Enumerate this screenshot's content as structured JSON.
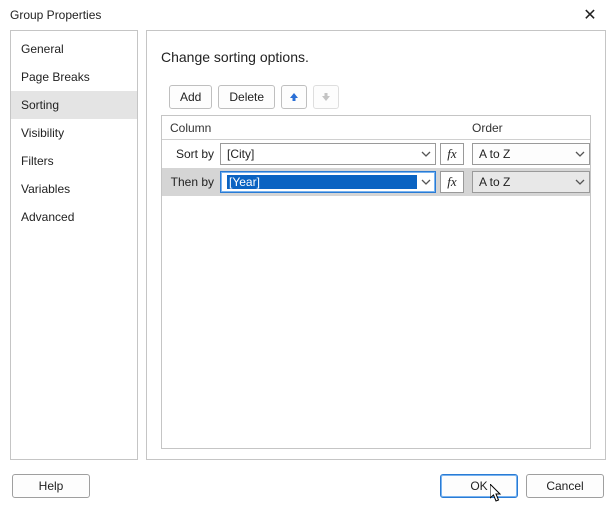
{
  "window": {
    "title": "Group Properties",
    "close_glyph": "✕"
  },
  "sidebar": {
    "items": [
      {
        "label": "General"
      },
      {
        "label": "Page Breaks"
      },
      {
        "label": "Sorting"
      },
      {
        "label": "Visibility"
      },
      {
        "label": "Filters"
      },
      {
        "label": "Variables"
      },
      {
        "label": "Advanced"
      }
    ],
    "selected_index": 2
  },
  "main": {
    "heading": "Change sorting options.",
    "toolbar": {
      "add_label": "Add",
      "delete_label": "Delete"
    },
    "grid": {
      "column_header": "Column",
      "order_header": "Order",
      "rows": [
        {
          "label": "Sort by",
          "value": "[City]",
          "order": "A to Z",
          "selected": false
        },
        {
          "label": "Then by",
          "value": "[Year]",
          "order": "A to Z",
          "selected": true
        }
      ]
    },
    "fx_label": "fx"
  },
  "footer": {
    "help_label": "Help",
    "ok_label": "OK",
    "cancel_label": "Cancel"
  }
}
